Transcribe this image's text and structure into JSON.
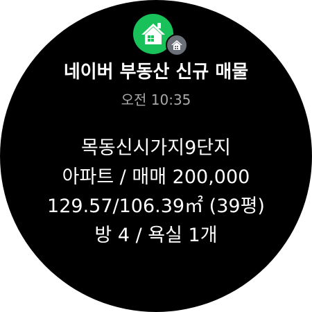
{
  "app": {
    "title": "네이버 부동산 신규 매물",
    "icon": "naver-real-estate-house-icon",
    "badge_icon": "house-badge-icon",
    "accent_color": "#19c15a"
  },
  "notification": {
    "time": "오전 10:35",
    "lines": [
      "목동신시가지9단지",
      "아파트 / 매매 200,000",
      "129.57/106.39㎡ (39평)",
      "방 4 / 욕실 1개"
    ]
  }
}
